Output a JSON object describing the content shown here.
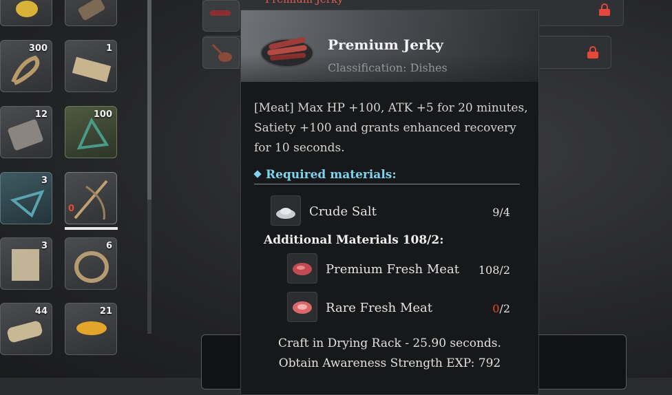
{
  "inventory": {
    "slots": [
      {
        "qty": "",
        "icon": "ore-icon"
      },
      {
        "qty": "",
        "icon": "bark-icon"
      },
      {
        "qty": "300",
        "icon": "rope-icon"
      },
      {
        "qty": "1",
        "icon": "fence-icon"
      },
      {
        "qty": "12",
        "icon": "leather-icon"
      },
      {
        "qty": "100",
        "icon": "frame-icon"
      },
      {
        "qty": "3",
        "icon": "frame-icon"
      },
      {
        "qty": "0",
        "icon": "crossbow-icon"
      },
      {
        "qty": "3",
        "icon": "panel-icon"
      },
      {
        "qty": "6",
        "icon": "coil-icon"
      },
      {
        "qty": "44",
        "icon": "scroll-icon"
      },
      {
        "qty": "21",
        "icon": "bowl-icon"
      }
    ]
  },
  "recipes": [
    {
      "title": "Premium Jerky",
      "locked": true
    },
    {
      "title": "",
      "locked": true
    }
  ],
  "tooltip": {
    "title": "Premium Jerky",
    "classification": "Classification: Dishes",
    "description": "[Meat] Max HP +100, ATK +5 for 20 minutes, Satiety +100 and grants enhanced recovery for 10 seconds.",
    "required_label": "Required materials:",
    "materials": [
      {
        "name": "Crude Salt",
        "have": "9",
        "need": "4",
        "icon": "salt-icon"
      }
    ],
    "additional_label": "Additional Materials 108/2:",
    "additional": [
      {
        "name": "Premium Fresh Meat",
        "have": "108",
        "need": "2",
        "icon": "meat-icon"
      },
      {
        "name": "Rare Fresh Meat",
        "have": "0",
        "need": "2",
        "icon": "rare-meat-icon"
      }
    ],
    "craft": "Craft in Drying Rack - 25.90 seconds.",
    "exp": "Obtain Awareness Strength EXP: 792"
  },
  "colors": {
    "accent": "#7fd3ee",
    "warning": "#e24a3a",
    "lock": "#e5483a"
  }
}
